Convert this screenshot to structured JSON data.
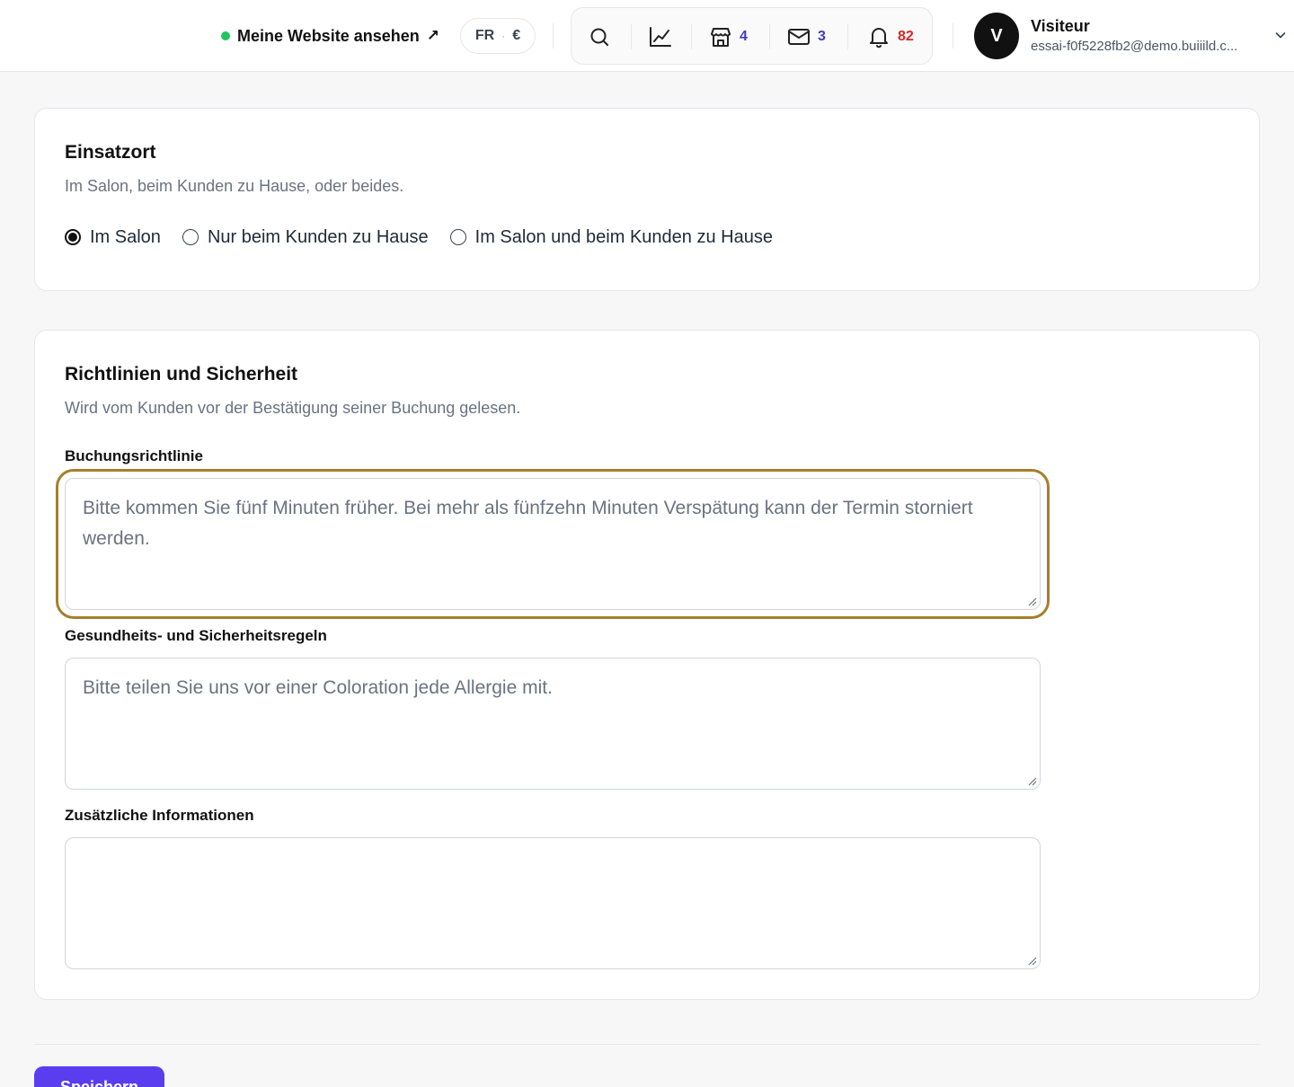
{
  "header": {
    "site_link_label": "Meine Website ansehen",
    "site_link_arrow": "↗",
    "locale": {
      "language": "FR",
      "separator": "·",
      "currency": "€"
    },
    "toolbar": {
      "search_icon": "search-icon",
      "analytics_icon": "chart-line-icon",
      "store_icon": "store-icon",
      "store_count": "4",
      "mail_icon": "mail-icon",
      "mail_count": "3",
      "bell_icon": "bell-icon",
      "notifications_count": "82"
    },
    "user": {
      "initial": "V",
      "name": "Visiteur",
      "email": "essai-f0f5228fb2@demo.buiiild.c..."
    }
  },
  "location_section": {
    "title": "Einsatzort",
    "subtitle": "Im Salon, beim Kunden zu Hause, oder beides.",
    "options": [
      {
        "label": "Im Salon",
        "selected": true
      },
      {
        "label": "Nur beim Kunden zu Hause",
        "selected": false
      },
      {
        "label": "Im Salon und beim Kunden zu Hause",
        "selected": false
      }
    ]
  },
  "policy_section": {
    "title": "Richtlinien und Sicherheit",
    "subtitle": "Wird vom Kunden vor der Bestätigung seiner Buchung gelesen.",
    "fields": [
      {
        "label": "Buchungsrichtlinie",
        "placeholder": "Bitte kommen Sie fünf Minuten früher. Bei mehr als fünfzehn Minuten Verspätung kann der Termin storniert werden.",
        "value": ""
      },
      {
        "label": "Gesundheits- und Sicherheitsregeln",
        "placeholder": "Bitte teilen Sie uns vor einer Coloration jede Allergie mit.",
        "value": ""
      },
      {
        "label": "Zusätzliche Informationen",
        "placeholder": "",
        "value": ""
      }
    ]
  },
  "footer": {
    "save_label": "Speichern"
  },
  "colors": {
    "accent": "#5b3df0",
    "focus_ring": "#a57f2c",
    "count_blue": "#4338ca",
    "count_red": "#dc2626",
    "online": "#22c55e"
  }
}
